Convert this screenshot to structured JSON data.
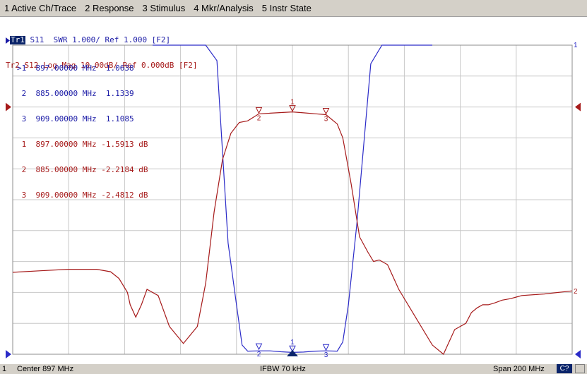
{
  "menu": [
    "1 Active Ch/Trace",
    "2 Response",
    "3 Stimulus",
    "4 Mkr/Analysis",
    "5 Instr State"
  ],
  "traces": [
    {
      "id": "Tr1",
      "text": " S11  SWR 1.000/ Ref 1.000 [F2]",
      "color": "#1a1aa6"
    },
    {
      "id": "Tr2",
      "text": " S12 Log Mag 10.00dB/ Ref 0.000dB [F2]",
      "color": "#a61a1a"
    }
  ],
  "markers_tr1": [
    {
      "label": ">1",
      "freq": "897.00000 MHz",
      "value": "1.0638"
    },
    {
      "label": " 2",
      "freq": "885.00000 MHz",
      "value": "1.1339"
    },
    {
      "label": " 3",
      "freq": "909.00000 MHz",
      "value": "1.1085"
    }
  ],
  "markers_tr2": [
    {
      "label": " 1",
      "freq": "897.00000 MHz",
      "value": "-1.5913 dB"
    },
    {
      "label": " 2",
      "freq": "885.00000 MHz",
      "value": "-2.2184 dB"
    },
    {
      "label": " 3",
      "freq": "909.00000 MHz",
      "value": "-2.4812 dB"
    }
  ],
  "chart_data": {
    "type": "line",
    "x_center_mhz": 897,
    "x_span_mhz": 200,
    "xlim": [
      797,
      997
    ],
    "grid": true,
    "x_divisions": 10,
    "y_divisions": 10,
    "series": [
      {
        "name": "Tr1",
        "color": "#2b2bc8",
        "scale_per_div": 1.0,
        "ref_value": 1.0,
        "ref_division": 0,
        "x": [
          847,
          866,
          870,
          874,
          877,
          879,
          881,
          885,
          889,
          893,
          897,
          901,
          905,
          909,
          913,
          915,
          917,
          920,
          925,
          929,
          947
        ],
        "y": [
          20,
          20,
          10.5,
          4.6,
          2.6,
          1.3,
          1.1,
          1.11,
          1.11,
          1.08,
          1.06,
          1.07,
          1.1,
          1.11,
          1.1,
          1.4,
          2.6,
          5.2,
          10.4,
          20,
          20
        ],
        "markers": [
          {
            "n": "1",
            "x": 897,
            "y": 1.0638
          },
          {
            "n": "2",
            "x": 885,
            "y": 1.1339
          },
          {
            "n": "3",
            "x": 909,
            "y": 1.1085
          }
        ]
      },
      {
        "name": "Tr2",
        "color": "#a61a1a",
        "scale_per_div": 10.0,
        "ref_value": 0.0,
        "ref_division": 8,
        "x": [
          797,
          807,
          817,
          827,
          832,
          835,
          838,
          839,
          841,
          843,
          845,
          849,
          853,
          858,
          863,
          866,
          869,
          872,
          875,
          878,
          881,
          885,
          889,
          893,
          897,
          901,
          905,
          909,
          913,
          915,
          918,
          921,
          924,
          926,
          928,
          931,
          933,
          935,
          941,
          947,
          951,
          955,
          959,
          961,
          963,
          965,
          967,
          969,
          972,
          975,
          977,
          979,
          987,
          997
        ],
        "y": [
          -53.5,
          -53,
          -52.5,
          -52.5,
          -53.3,
          -55.5,
          -60,
          -64,
          -68,
          -64,
          -59,
          -61,
          -71,
          -76.5,
          -71,
          -57,
          -34,
          -17,
          -8.5,
          -5,
          -4.5,
          -2.21,
          -2,
          -1.8,
          -1.59,
          -1.9,
          -2.2,
          -2.48,
          -5.5,
          -10,
          -25,
          -42,
          -47,
          -50,
          -49.5,
          -51,
          -55,
          -59,
          -68,
          -77,
          -80,
          -72,
          -70,
          -66.5,
          -65,
          -64,
          -64,
          -63.5,
          -62.5,
          -62,
          -61.5,
          -61,
          -60.5,
          -59.5
        ],
        "markers": [
          {
            "n": "1",
            "x": 897,
            "y": -1.5913
          },
          {
            "n": "2",
            "x": 885,
            "y": -2.2184
          },
          {
            "n": "3",
            "x": 909,
            "y": -2.4812
          }
        ]
      }
    ]
  },
  "axis_labels": {
    "tr1_ref": "1",
    "tr2_ref": "2"
  },
  "status": {
    "channel": "1",
    "center": "Center 897 MHz",
    "ifbw": "IFBW 70 kHz",
    "span": "Span 200 MHz",
    "cal": "C?"
  }
}
